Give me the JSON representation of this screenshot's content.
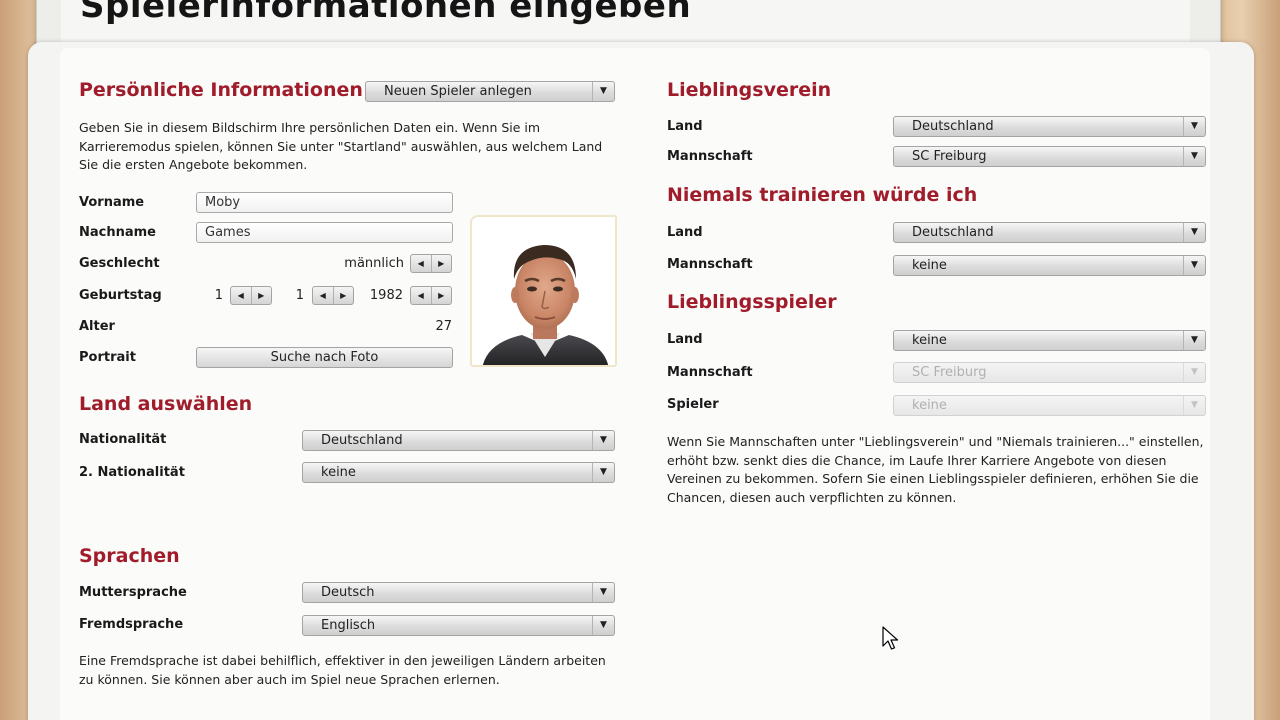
{
  "page_title": "Spielerinformationen eingeben",
  "left": {
    "personal": {
      "title": "Persönliche Informationen",
      "preset_select": "Neuen Spieler anlegen",
      "description": "Geben Sie in diesem Bildschirm Ihre persönlichen Daten ein. Wenn Sie im Karrieremodus spielen, können Sie unter \"Startland\" auswählen, aus welchem Land Sie die ersten Angebote bekommen.",
      "firstname_label": "Vorname",
      "firstname_value": "Moby",
      "lastname_label": "Nachname",
      "lastname_value": "Games",
      "gender_label": "Geschlecht",
      "gender_value": "männlich",
      "birthday_label": "Geburtstag",
      "birthday_day": "1",
      "birthday_month": "1",
      "birthday_year": "1982",
      "age_label": "Alter",
      "age_value": "27",
      "portrait_label": "Portrait",
      "photo_button": "Suche nach Foto"
    },
    "country": {
      "title": "Land auswählen",
      "nationality_label": "Nationalität",
      "nationality_value": "Deutschland",
      "nationality2_label": "2. Nationalität",
      "nationality2_value": "keine"
    },
    "languages": {
      "title": "Sprachen",
      "native_label": "Muttersprache",
      "native_value": "Deutsch",
      "foreign_label": "Fremdsprache",
      "foreign_value": "Englisch",
      "description": "Eine Fremdsprache ist dabei behilflich, effektiver in den jeweiligen Ländern arbeiten zu können. Sie können aber auch im Spiel neue Sprachen erlernen."
    }
  },
  "right": {
    "favorite_club": {
      "title": "Lieblingsverein",
      "country_label": "Land",
      "country_value": "Deutschland",
      "team_label": "Mannschaft",
      "team_value": "SC Freiburg"
    },
    "never_train": {
      "title": "Niemals trainieren würde ich",
      "country_label": "Land",
      "country_value": "Deutschland",
      "team_label": "Mannschaft",
      "team_value": "keine"
    },
    "favorite_player": {
      "title": "Lieblingsspieler",
      "country_label": "Land",
      "country_value": "keine",
      "team_label": "Mannschaft",
      "team_value": "SC Freiburg",
      "player_label": "Spieler",
      "player_value": "keine"
    },
    "description": "Wenn Sie Mannschaften unter \"Lieblingsverein\" und \"Niemals trainieren...\" einstellen, erhöht bzw. senkt dies die Chance, im Laufe Ihrer Karriere Angebote von diesen Vereinen zu bekommen. Sofern Sie einen Lieblingsspieler definieren, erhöhen Sie die Chancen, diesen auch verpflichten zu können."
  },
  "icons": {
    "dropdown_arrow": "▼",
    "spin_left": "◀",
    "spin_right": "▶"
  },
  "colors": {
    "section_title": "#a01c2a"
  }
}
